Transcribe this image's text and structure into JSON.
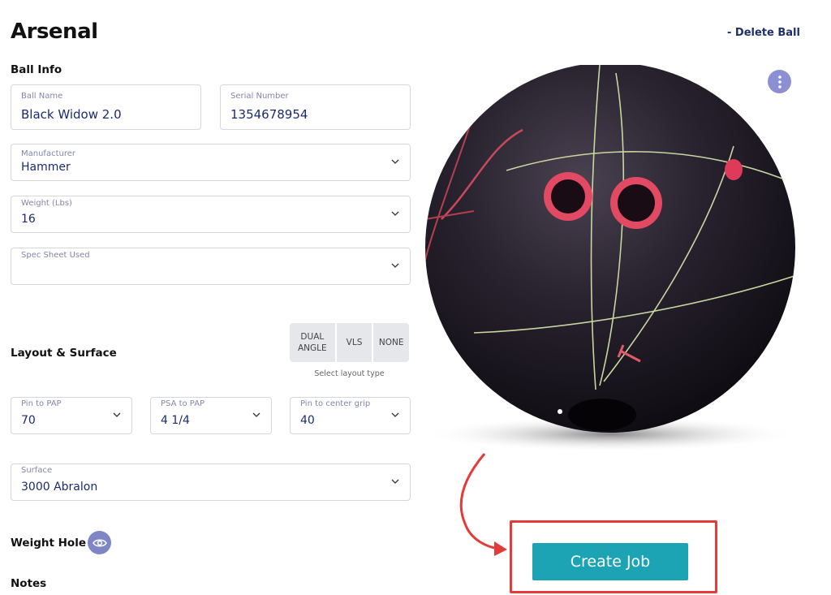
{
  "page": {
    "title": "Arsenal",
    "delete_label": "- Delete Ball"
  },
  "ball_info": {
    "heading": "Ball Info",
    "ball_name": {
      "label": "Ball Name",
      "value": "Black Widow 2.0"
    },
    "serial_number": {
      "label": "Serial Number",
      "value": "1354678954"
    },
    "manufacturer": {
      "label": "Manufacturer",
      "value": "Hammer"
    },
    "weight": {
      "label": "Weight (Lbs)",
      "value": "16"
    },
    "spec_sheet": {
      "label": "Spec Sheet Used",
      "value": ""
    }
  },
  "layout_surface": {
    "heading": "Layout & Surface",
    "layout_types": [
      "DUAL ANGLE",
      "VLS",
      "NONE"
    ],
    "select_caption": "Select layout type",
    "pin_to_pap": {
      "label": "Pin to PAP",
      "value": "70"
    },
    "psa_to_pap": {
      "label": "PSA to PAP",
      "value": "4 1/4"
    },
    "pin_to_center_grip": {
      "label": "Pin to center grip",
      "value": "40"
    },
    "surface": {
      "label": "Surface",
      "value": "3000 Abralon"
    }
  },
  "weight_hole": {
    "heading": "Weight Hole",
    "icon": "eye-icon"
  },
  "notes": {
    "heading": "Notes"
  },
  "actions": {
    "create_job_label": "Create Job"
  },
  "colors": {
    "value_text": "#1b2b6e",
    "accent_button": "#1ca4b5",
    "icon_button": "#7f86c6",
    "highlight": "#e53a3a"
  },
  "icons": {
    "menu": "more-vertical-icon",
    "dropdown": "chevron-down-icon"
  }
}
